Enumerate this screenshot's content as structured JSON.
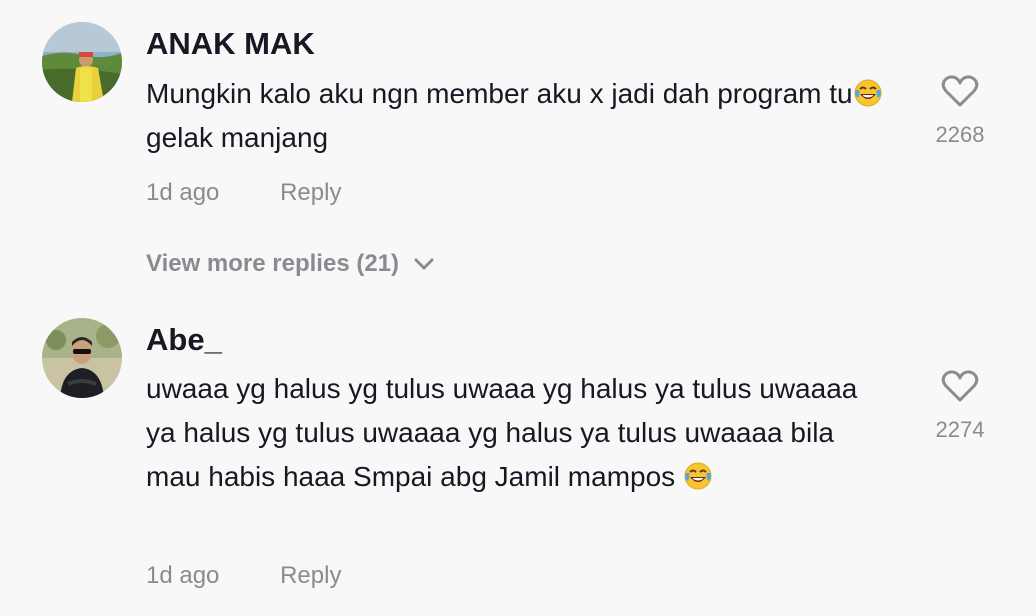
{
  "comments": [
    {
      "username": "ANAK MAK",
      "text_before_emoji": "Mungkin kalo aku ngn member aku x jadi dah program tu",
      "text_after_emoji": " gelak manjang",
      "emoji": "face-with-tears-of-joy-icon",
      "time": "1d ago",
      "reply_label": "Reply",
      "like_count": "2268",
      "view_more_label": "View more replies (21)"
    },
    {
      "username": "Abe_",
      "text_before_emoji": "uwaaa yg halus yg tulus uwaaa yg halus ya tulus uwaaaa ya halus yg tulus uwaaaa yg halus ya tulus uwaaaa bila mau habis haaa Smpai abg Jamil mampos ",
      "text_after_emoji": "",
      "emoji": "face-with-tears-of-joy-icon",
      "time": "1d ago",
      "reply_label": "Reply",
      "like_count": "2274"
    }
  ],
  "colors": {
    "background": "#f8f8f8",
    "primary_text": "#161823",
    "secondary_text": "#8a8b91"
  }
}
